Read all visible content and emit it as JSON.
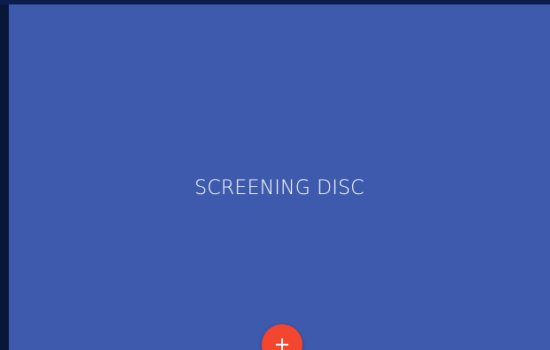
{
  "panel": {
    "title": "SCREENING DISC",
    "background_color": "#3e5aad"
  },
  "fab": {
    "icon": "plus-icon",
    "color": "#f4452e"
  }
}
